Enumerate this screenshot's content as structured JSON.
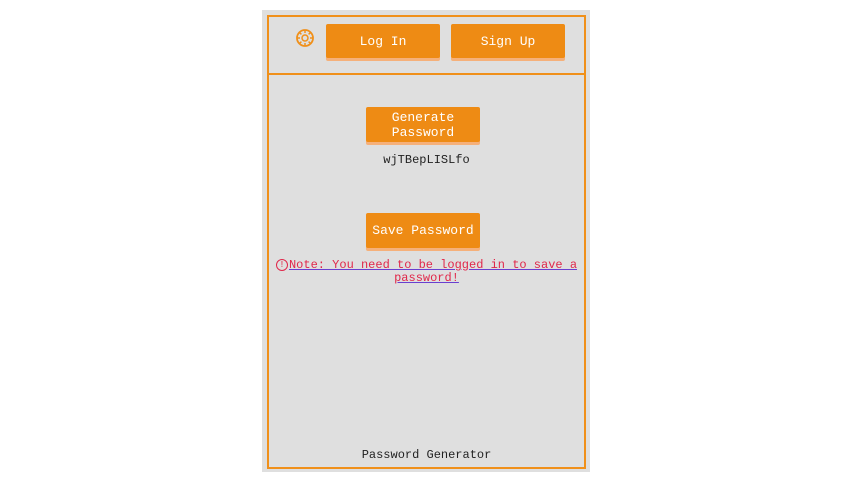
{
  "header": {
    "logo_icon": "gear-icon",
    "login_label": "Log In",
    "signup_label": "Sign Up"
  },
  "generator": {
    "generate_label": "Generate Password",
    "generated_password": "wjTBepLISLfo",
    "save_label": "Save Password",
    "note_icon": "warning-circle-icon",
    "note_text": "Note: You need to be logged in to save a password!"
  },
  "footer": {
    "title": "Password Generator"
  },
  "colors": {
    "accent": "#ee8b14",
    "panel_bg": "#dfdfdf",
    "warning": "#e0274a"
  }
}
